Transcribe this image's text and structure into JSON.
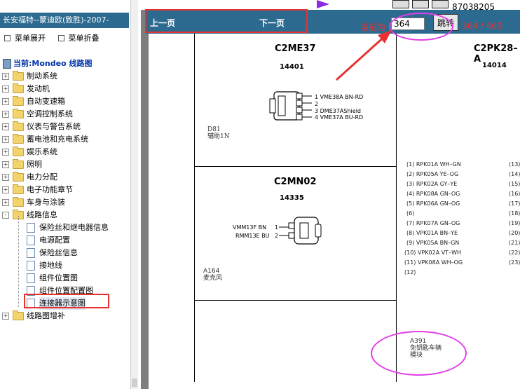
{
  "sidebar": {
    "title": "长安福特--蒙迪欧(致胜)-2007-",
    "expand_label": "菜单展开",
    "collapse_label": "菜单折叠",
    "current_label": "当前:Mondeo 线路图",
    "tree": [
      {
        "label": "制动系统",
        "expander": "+"
      },
      {
        "label": "发动机",
        "expander": "+"
      },
      {
        "label": "自动变速箱",
        "expander": "+"
      },
      {
        "label": "空调控制系统",
        "expander": "+"
      },
      {
        "label": "仪表与警告系统",
        "expander": "+"
      },
      {
        "label": "蓄电池和充电系统",
        "expander": "+"
      },
      {
        "label": "娱乐系统",
        "expander": "+"
      },
      {
        "label": "照明",
        "expander": "+"
      },
      {
        "label": "电力分配",
        "expander": "+"
      },
      {
        "label": "电子功能章节",
        "expander": "+"
      },
      {
        "label": "车身与涂装",
        "expander": "+"
      },
      {
        "label": "线路信息",
        "expander": "-"
      }
    ],
    "children": [
      {
        "label": "保险丝和继电器信息"
      },
      {
        "label": "电源配置"
      },
      {
        "label": "保险丝信息"
      },
      {
        "label": "接地线"
      },
      {
        "label": "组件位置图"
      },
      {
        "label": "组件位置配置图"
      },
      {
        "label": "连接器示意图"
      }
    ],
    "last_node": {
      "label": "线路图增补",
      "expander": "+"
    }
  },
  "toolbar": {
    "prev_label": "上一页",
    "next_label": "下一页",
    "current_page_label": "当前为",
    "page_value": "364",
    "jump_label": "跳转",
    "page_count": "364 / 460",
    "phone": "87038205"
  },
  "diagram": {
    "c1": {
      "name": "C2ME37",
      "num": "14401",
      "pins": [
        "1  VME38A BN-RD",
        "2",
        "3  DME37AShield",
        "4  VME37A BU-RD"
      ],
      "loc_code": "D81",
      "loc_name": "辅助1N"
    },
    "c2": {
      "name": "C2MN02",
      "num": "14335",
      "pin1": "VMM13F   BN",
      "pin2": "RMM13E BU",
      "pin1n": "1",
      "pin2n": "2",
      "loc_code": "A164",
      "loc_name": "麦克风"
    },
    "c3": {
      "name": "C2PK28–A",
      "num": "14014",
      "rows_left": [
        "(1)    RPK01A WH–GN",
        "(2)    RPK05A YE–OG",
        "(3)    RPK02A GY–YE",
        "(4)    RPK08A GN–OG",
        "(5)    RPK06A GN–OG",
        "(6)",
        "(7)    RPK07A GN–OG",
        "(8)    VPK01A BN–YE",
        "(9)    VPK05A BN–GN",
        "(10)   VPK02A VT–WH",
        "(11)   VPK08A WH–OG",
        "(12)"
      ],
      "rows_right": [
        "(13)",
        "(14)",
        "(15)",
        "(16)",
        "(17)",
        "(18)",
        "(19)",
        "(20)",
        "(21)",
        "(22)",
        "(23)"
      ],
      "loc_code": "A391",
      "loc_name1": "免钥匙车辆",
      "loc_name2": "模块"
    }
  }
}
